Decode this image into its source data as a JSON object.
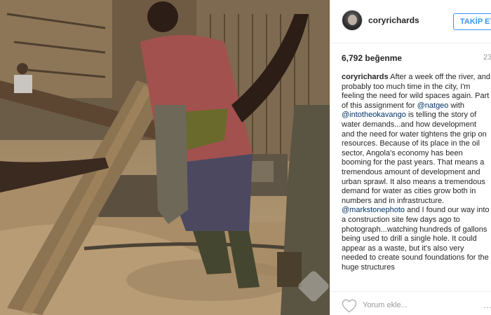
{
  "post": {
    "username": "coryrichards",
    "follow_label": "TAKİP ET",
    "likes": "6,792 beğenme",
    "time": "23",
    "caption": {
      "username": "coryrichards",
      "segments": [
        {
          "type": "text",
          "text": " After a week off the river, and probably too much time in the city, I'm feeling the need for wild spaces again. Part of this assignment for "
        },
        {
          "type": "mention",
          "text": "@natgeo"
        },
        {
          "type": "text",
          "text": " with "
        },
        {
          "type": "mention",
          "text": "@intotheokavango"
        },
        {
          "type": "text",
          "text": " is telling the story of water demands...and how development and the need for water tightens the grip on resources. Because of its place in the oil sector, Angola's economy has been booming for the past years. That means a tremendous amount of development and urban sprawl. It also means a tremendous demand for water as cities grow both in numbers and in infrastructure. "
        },
        {
          "type": "mention",
          "text": "@markstonephoto"
        },
        {
          "type": "text",
          "text": " and I found our way into a construction site few days ago to photograph...watching hundreds of gallons being used to drill a single hole. It could appear as a waste, but it's also very needed to create sound foundations for the huge structures"
        }
      ]
    },
    "comment_placeholder": "Yorum ekle...",
    "more_label": "..."
  },
  "icons": {
    "avatar": "profile-photo",
    "like": "heart-icon",
    "more": "more-options-icon",
    "watermark": "watermark-logo"
  },
  "colors": {
    "accent": "#3897f0",
    "mention": "#003569",
    "text": "#262626",
    "muted": "#999999"
  }
}
